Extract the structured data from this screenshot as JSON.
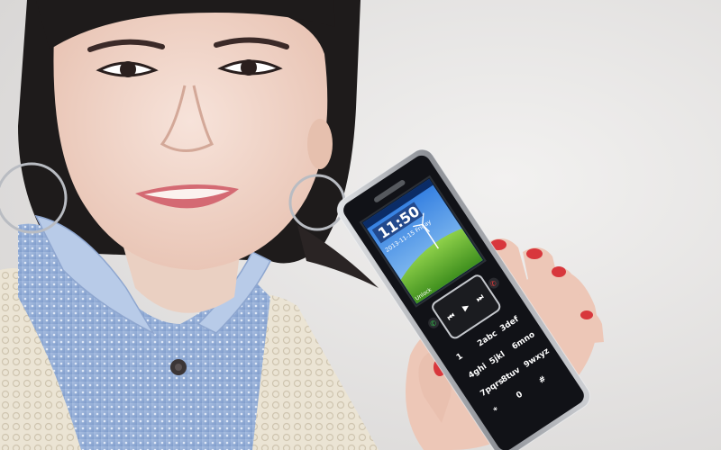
{
  "photo": {
    "colors": {
      "background": "#e9e7e6",
      "hair": "#1e1b1b",
      "skin": "#f1d6c9",
      "shirt": "#9fb6da",
      "cardigan": "#ece5d6",
      "lips": "#d46a73",
      "phone_body": "#111217",
      "phone_frame": "#b9bcc2",
      "nail_polish": "#d8373c"
    },
    "phone": {
      "clock": "11:50",
      "date": "2013-11-15 Friday",
      "softkey_left": "Unlock",
      "keys": [
        "1",
        "2abc",
        "3def",
        "4ghi",
        "5jkl",
        "6mno",
        "7pqrs",
        "8tuv",
        "9wxyz",
        "*",
        "0",
        "#"
      ]
    }
  }
}
